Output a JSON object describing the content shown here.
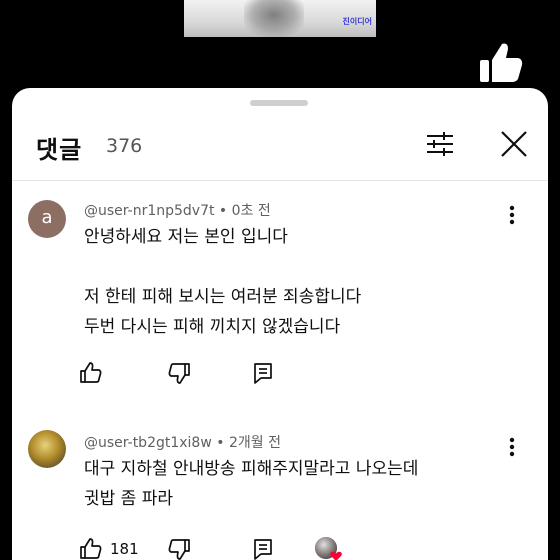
{
  "video": {
    "watermark": "진이디어"
  },
  "sheet": {
    "title": "댓글",
    "count": "376"
  },
  "comments": [
    {
      "author": "@user-nr1np5dv7t",
      "time": "0초 전",
      "avatar_letter": "a",
      "avatar_color": "#8d6e63",
      "body": "안녕하세요 저는 본인 입니다\n\n저 한테 피해 보시는 여러분 죄송합니다\n두번 다시는 피해 끼치지 않겠습니다",
      "likes": ""
    },
    {
      "author": "@user-tb2gt1xi8w",
      "time": "2개월 전",
      "body": "대구 지하철 안내방송 피해주지말라고 나오는데\n귓밥 좀 파라",
      "likes": "181"
    }
  ],
  "icons": [
    "thumb-up-icon",
    "thumb-down-icon",
    "reply-icon",
    "more-vert-icon",
    "sort-icon",
    "close-icon",
    "creator-heart-icon"
  ]
}
